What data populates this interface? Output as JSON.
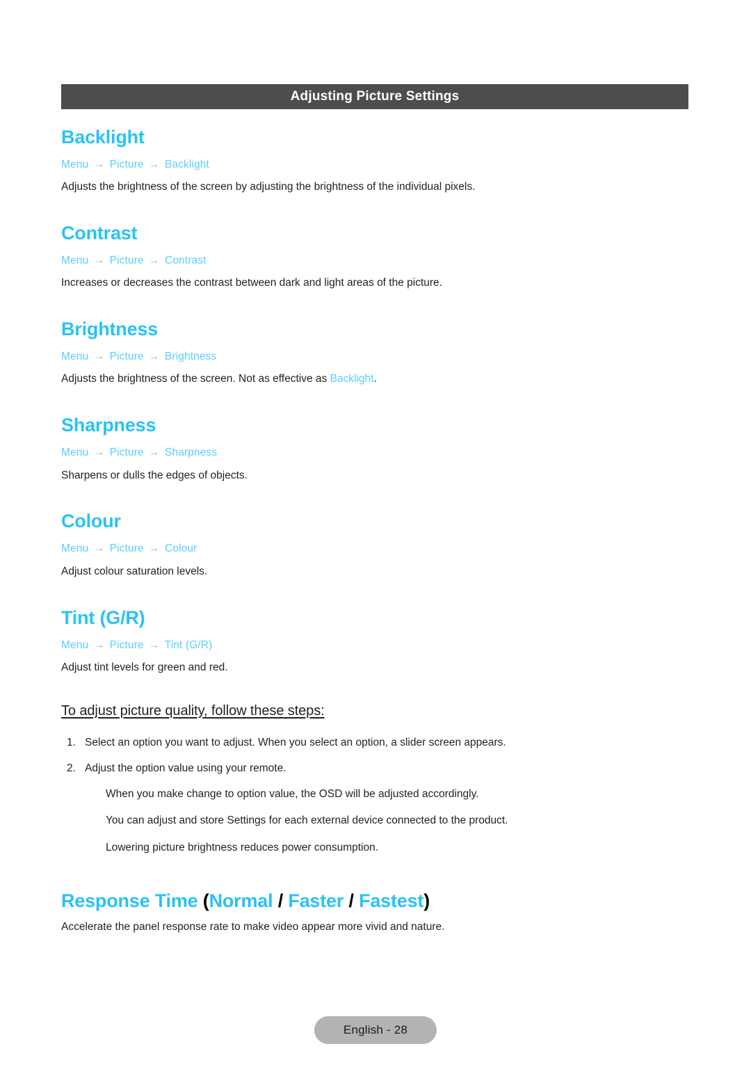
{
  "section_header": {
    "title": "Adjusting Picture Settings"
  },
  "topics": [
    {
      "title": "Backlight",
      "breadcrumb": {
        "root": "Menu",
        "mid": "Picture",
        "leaf": "Backlight",
        "arrow": "→"
      },
      "description": "Adjusts the brightness of the screen by adjusting the brightness of the individual pixels."
    },
    {
      "title": "Contrast",
      "breadcrumb": {
        "root": "Menu",
        "mid": "Picture",
        "leaf": "Contrast",
        "arrow": "→"
      },
      "description": "Increases or decreases the contrast between dark and light areas of the picture."
    },
    {
      "title": "Brightness",
      "breadcrumb": {
        "root": "Menu",
        "mid": "Picture",
        "leaf": "Brightness",
        "arrow": "→"
      },
      "description_pre": "Adjusts the brightness of the screen. Not as effective as ",
      "description_link": "Backlight",
      "description_post": "."
    },
    {
      "title": "Sharpness",
      "breadcrumb": {
        "root": "Menu",
        "mid": "Picture",
        "leaf": "Sharpness",
        "arrow": "→"
      },
      "description": "Sharpens or dulls the edges of objects."
    },
    {
      "title": "Colour",
      "breadcrumb": {
        "root": "Menu",
        "mid": "Picture",
        "leaf": "Colour",
        "arrow": "→"
      },
      "description": "Adjust colour saturation levels."
    },
    {
      "title": "Tint (G/R)",
      "breadcrumb": {
        "root": "Menu",
        "mid": "Picture",
        "leaf": "Tint (G/R)",
        "arrow": "→"
      },
      "description": "Adjust tint levels for green and red."
    }
  ],
  "steps_block": {
    "heading": "To adjust picture quality, follow these steps:",
    "items": [
      {
        "number": "1.",
        "text": "Select an option you want to adjust. When you select an option, a slider screen appears."
      },
      {
        "number": "2.",
        "text": "Adjust the option value using your remote."
      }
    ],
    "notes": [
      "When you make change to option value, the OSD will be adjusted accordingly.",
      "You can adjust and store Settings for each external device connected to the product.",
      "Lowering picture brightness reduces power consumption."
    ]
  },
  "response_time": {
    "title_main": "Response Time ",
    "paren_open": "(",
    "opt1": "Normal",
    "sep1": " / ",
    "opt2": "Faster",
    "sep2": " / ",
    "opt3": "Fastest",
    "paren_close": ")",
    "description": "Accelerate the panel response rate to make video appear more vivid and nature."
  },
  "footer": {
    "page_label": "English - 28"
  },
  "colors": {
    "heading_blue": "#29c3f2",
    "link_blue": "#5ccdf6",
    "bar_gray": "#4d4d4d",
    "pill_gray": "#b3b3b3",
    "body_black": "#231f20"
  }
}
